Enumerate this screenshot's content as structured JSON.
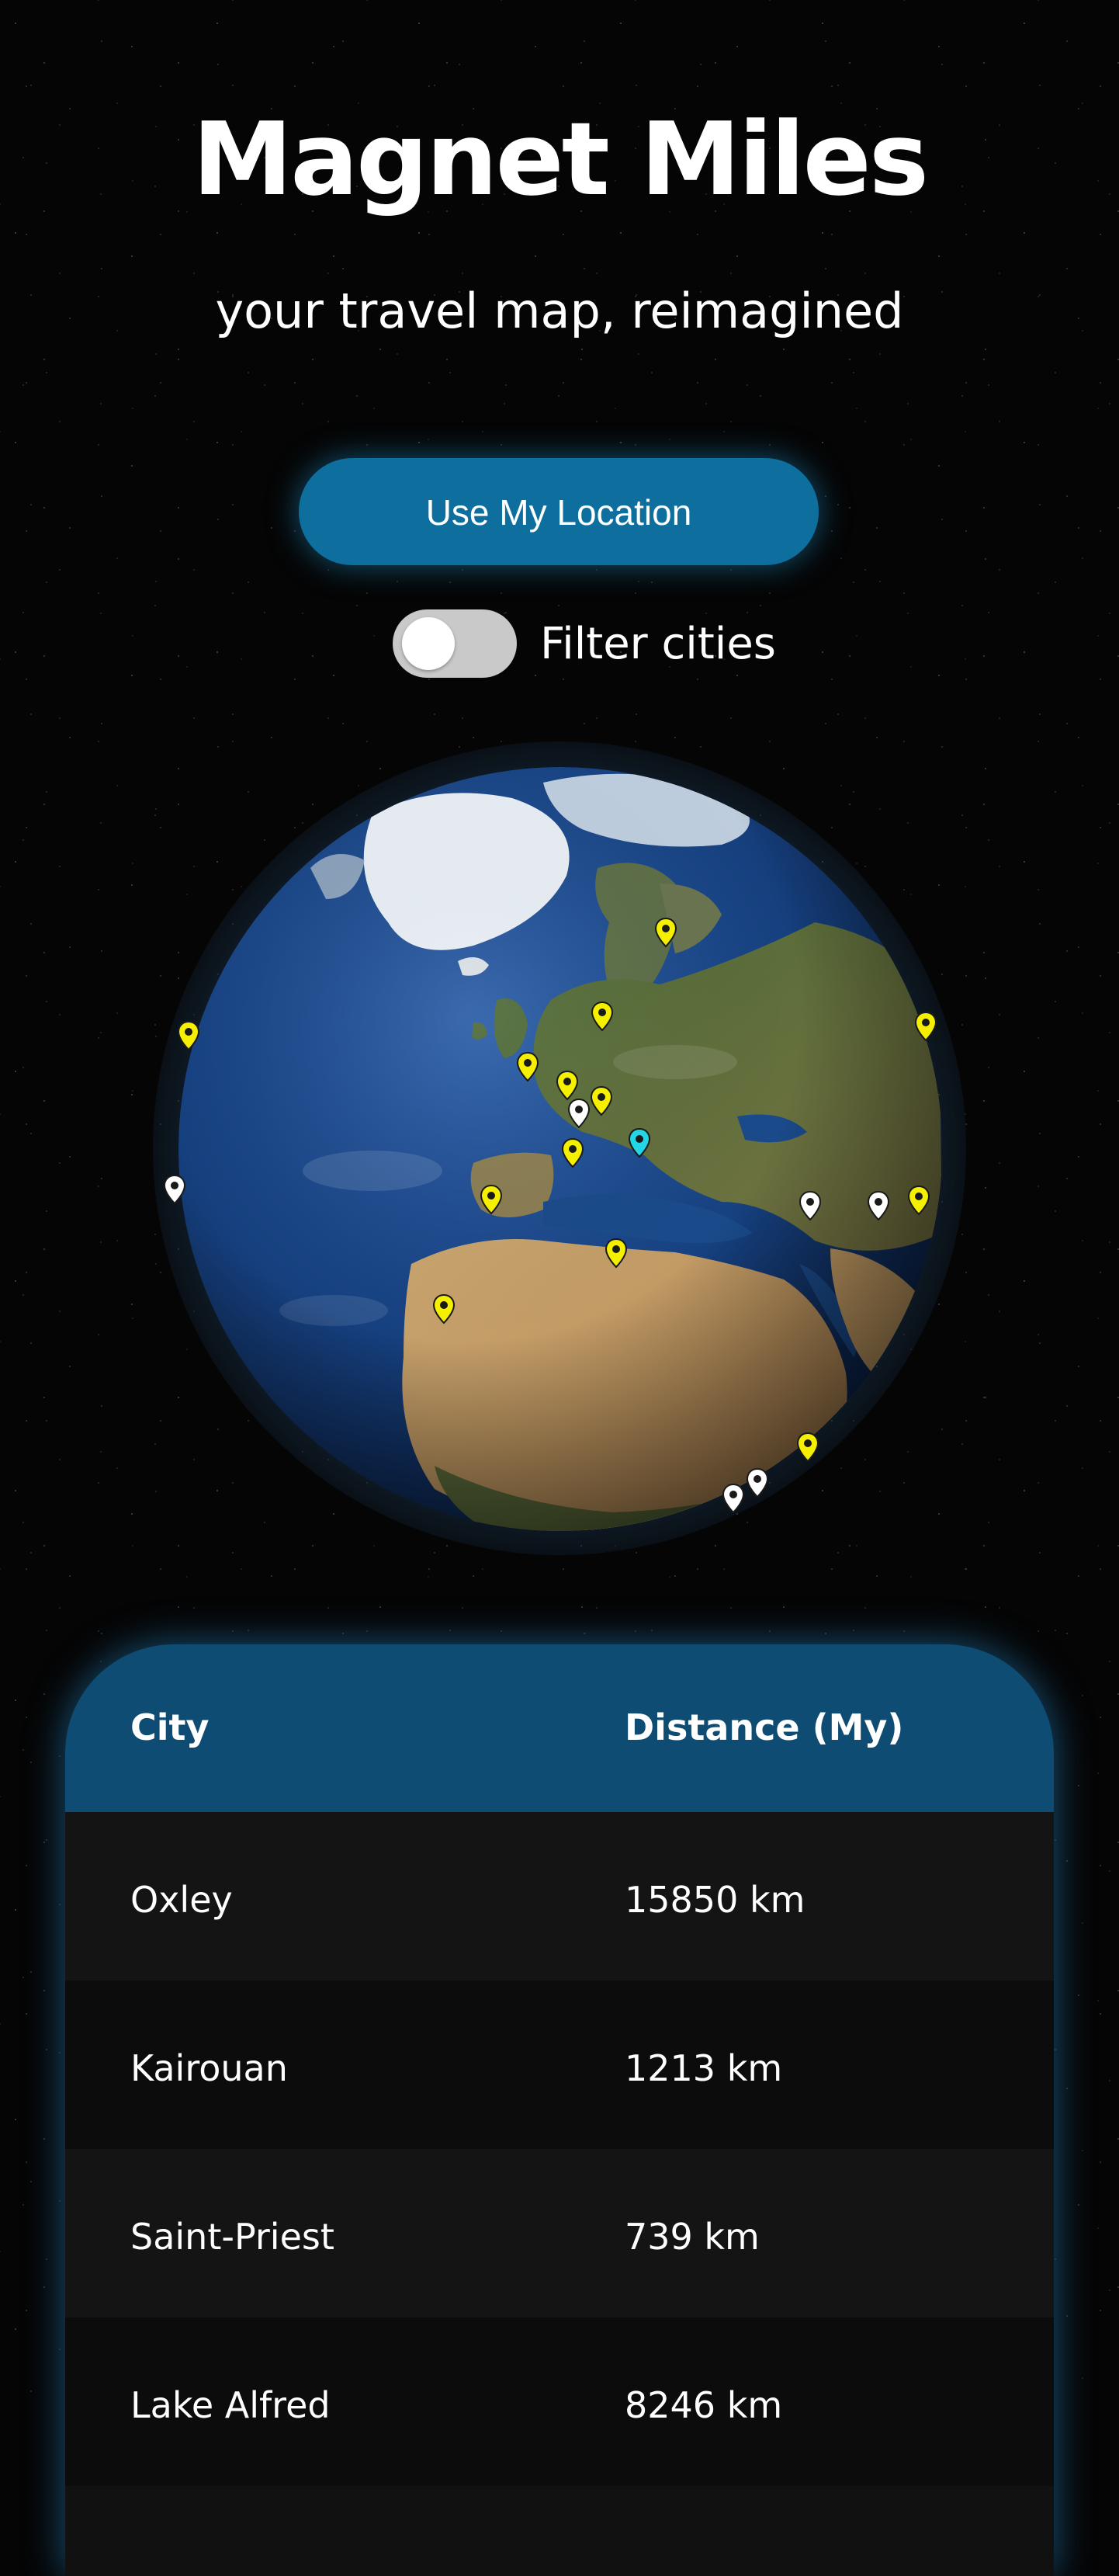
{
  "app": {
    "title": "Magnet Miles",
    "subtitle": "your travel map, reimagined"
  },
  "controls": {
    "location_button": "Use My Location",
    "filter_label": "Filter cities",
    "filter_enabled": false
  },
  "globe": {
    "pin_colors": {
      "active": "#f5f000",
      "inactive": "#ffffff",
      "current": "#22d6e6"
    }
  },
  "table": {
    "headers": {
      "city": "City",
      "distance": "Distance (My)"
    },
    "rows": [
      {
        "city": "Oxley",
        "distance": "15850 km"
      },
      {
        "city": "Kairouan",
        "distance": "1213 km"
      },
      {
        "city": "Saint-Priest",
        "distance": "739 km"
      },
      {
        "city": "Lake Alfred",
        "distance": "8246 km"
      }
    ]
  },
  "colors": {
    "accent": "#0e6f9e",
    "table_header": "#0f4c74",
    "background": "#050505"
  }
}
